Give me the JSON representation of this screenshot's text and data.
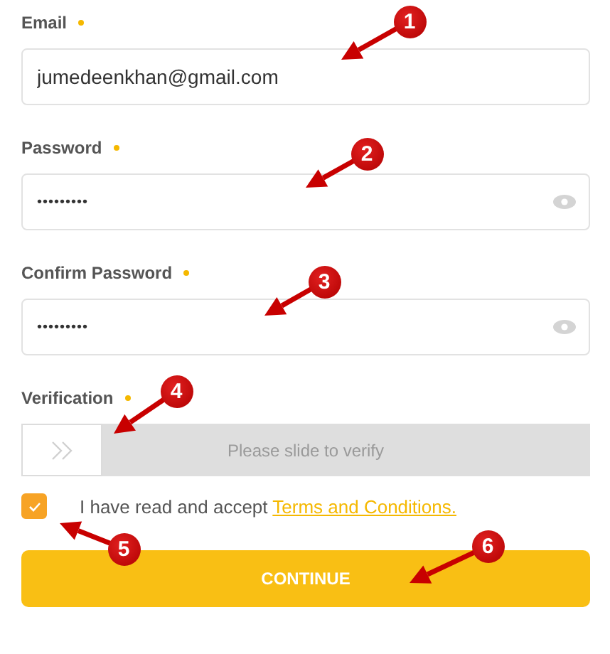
{
  "fields": [
    {
      "label": "Email",
      "required": true,
      "value": "jumedeenkhan@gmail.com",
      "kind": "text"
    },
    {
      "label": "Password",
      "required": true,
      "value": "•••••••••",
      "kind": "password"
    },
    {
      "label": "Confirm Password",
      "required": true,
      "value": "•••••••••",
      "kind": "password"
    }
  ],
  "verification": {
    "label": "Verification",
    "required": true,
    "hint": "Please slide to verify",
    "level": 0
  },
  "agreement": {
    "checked": true,
    "text": "I have read and accept",
    "link": "Terms and Conditions."
  },
  "button": "CONTINUE",
  "annotations": [
    {
      "number": "1"
    },
    {
      "number": "2"
    },
    {
      "number": "3"
    },
    {
      "number": "4"
    },
    {
      "number": "5"
    },
    {
      "number": "6"
    }
  ]
}
